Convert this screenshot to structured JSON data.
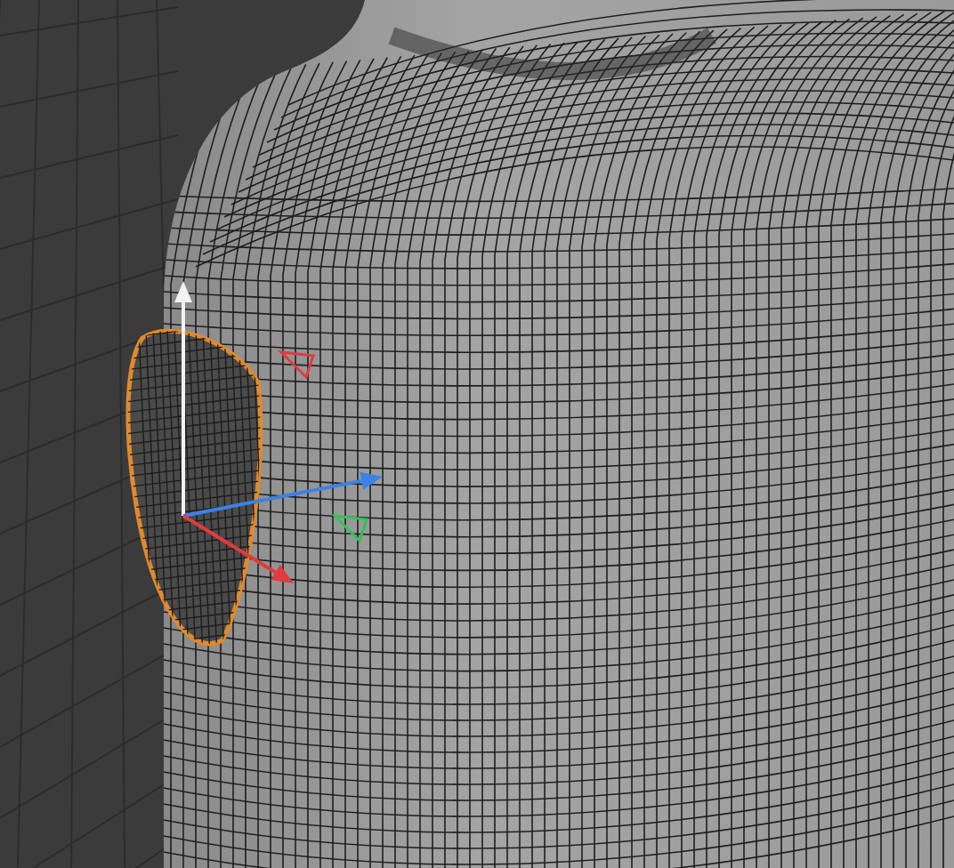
{
  "viewport": {
    "gizmo": {
      "axes": [
        {
          "kind": "up",
          "color": "#f2f2f2"
        },
        {
          "kind": "right",
          "color": "#3b82e6"
        },
        {
          "kind": "front",
          "color": "#e23b3b"
        }
      ],
      "planes": [
        {
          "kind": "top",
          "color": "#e23b3b"
        },
        {
          "kind": "bottom",
          "color": "#33c25a"
        }
      ]
    }
  }
}
